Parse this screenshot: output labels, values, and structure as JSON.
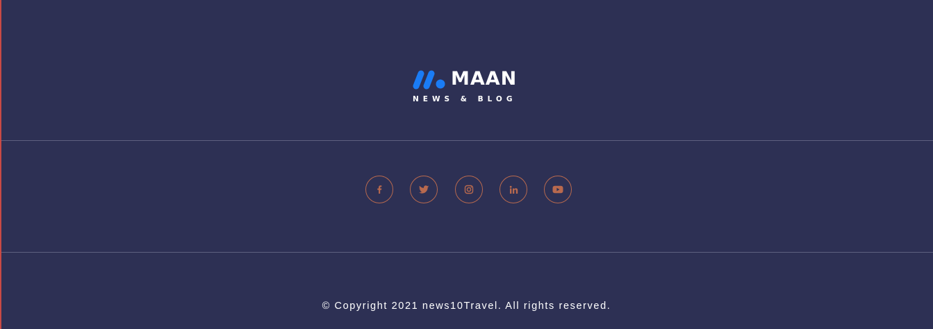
{
  "brand": {
    "name": "MAAN",
    "tagline": "NEWS & BLOG",
    "mark_color": "#1a7cf5"
  },
  "social": [
    {
      "name": "facebook",
      "icon": "facebook-icon"
    },
    {
      "name": "twitter",
      "icon": "twitter-icon"
    },
    {
      "name": "instagram",
      "icon": "instagram-icon"
    },
    {
      "name": "linkedin",
      "icon": "linkedin-icon"
    },
    {
      "name": "youtube",
      "icon": "youtube-icon"
    }
  ],
  "footer": {
    "copyright": "© Copyright 2021 news10Travel. All rights reserved."
  },
  "colors": {
    "background": "#2d3054",
    "accent": "#b8694e",
    "divider": "#5e6080",
    "left_edge": "#c94a45"
  }
}
